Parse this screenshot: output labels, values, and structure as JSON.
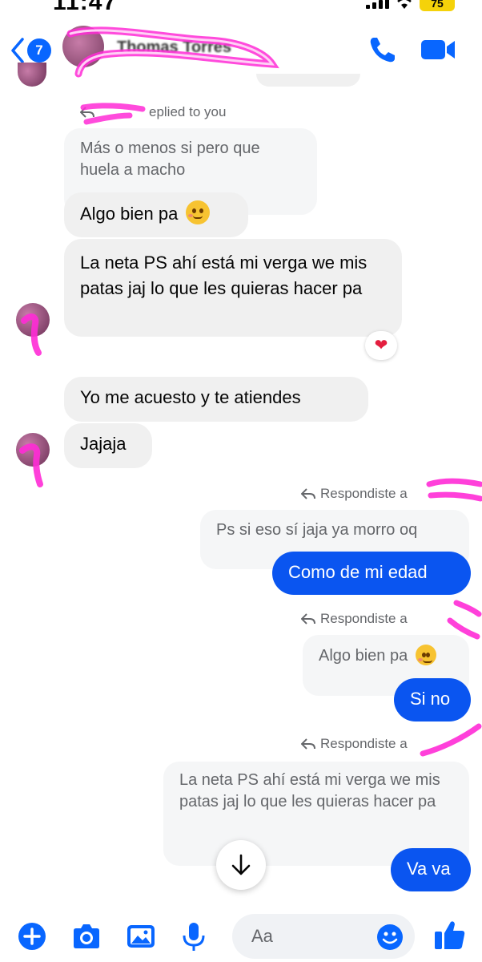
{
  "status_bar": {
    "time": "11:47",
    "battery": "75"
  },
  "header": {
    "back_badge": "7",
    "contact_name": "Thomas Torres"
  },
  "messages": {
    "reply_meta_1": "eplied to you",
    "quoted_1": "Más o menos si pero que huela a macho",
    "msg_1": "Algo bien pa",
    "msg_2": "La neta PS ahí está mi verga we mis patas jaj lo que les quieras hacer pa",
    "reaction_2": "❤",
    "msg_3": "Yo me acuesto y te atiendes",
    "msg_4": "Jajaja",
    "reply_meta_2": "Respondiste a",
    "quoted_2": "Ps si eso sí jaja ya morro oq",
    "out_1": "Como de mi edad",
    "reply_meta_3": "Respondiste a",
    "quoted_3": "Algo bien pa",
    "out_2": "Si no",
    "reply_meta_4": "Respondiste a",
    "quoted_4": "La neta PS ahí está mi verga we mis patas jaj lo que les quieras hacer pa",
    "out_3": "Va va"
  },
  "composer": {
    "placeholder": "Aa"
  },
  "colors": {
    "accent": "#0866ff",
    "outgoing_bubble": "#0a55f0",
    "incoming_bubble": "#f0f0f0",
    "scribble": "#ff2bd6"
  },
  "icons": [
    "back-chevron-icon",
    "phone-icon",
    "video-camera-icon",
    "reply-arrow-icon",
    "heart-icon",
    "arrow-down-icon",
    "plus-icon",
    "camera-icon",
    "image-icon",
    "microphone-icon",
    "emoji-icon",
    "thumbs-up-icon"
  ]
}
